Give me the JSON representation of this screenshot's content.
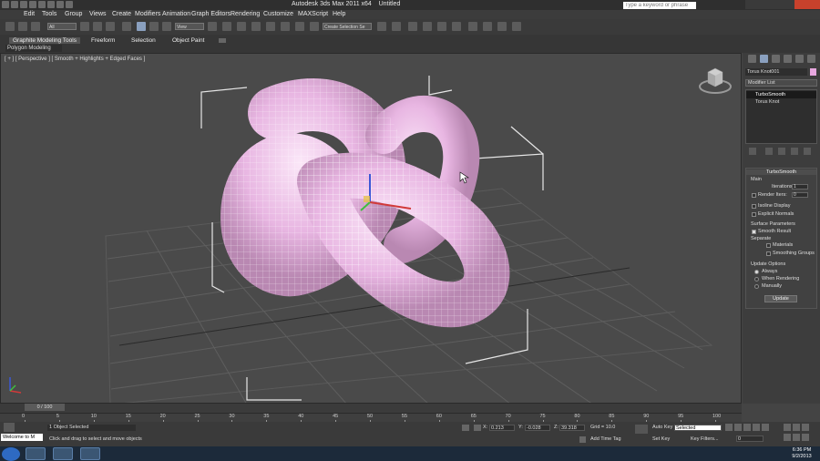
{
  "app": {
    "title": "Autodesk 3ds Max 2011 x64",
    "document": "Untitled",
    "search_placeholder": "Type a keyword or phrase"
  },
  "menu": [
    "Edit",
    "Tools",
    "Group",
    "Views",
    "Create",
    "Modifiers",
    "Animation",
    "Graph Editors",
    "Rendering",
    "Customize",
    "MAXScript",
    "Help"
  ],
  "toolbar": {
    "selection_filter": "All",
    "ref_coord": "View",
    "named_selection": "Create Selection Se"
  },
  "ribbon": {
    "tabs": [
      "Graphite Modeling Tools",
      "Freeform",
      "Selection",
      "Object Paint"
    ],
    "subtab": "Polygon Modeling"
  },
  "viewport": {
    "label": "[ + ] [ Perspective ] [ Smooth + Highlights + Edged Faces ]",
    "object_color": "#e8b6e2"
  },
  "command_panel": {
    "object_name": "Torus Knot001",
    "object_color": "#e8a8e0",
    "modifier_list": "Modifier List",
    "stack": [
      "TurboSmooth",
      "Torus Knot"
    ],
    "rollout": {
      "title": "TurboSmooth",
      "main_group": "Main",
      "iterations_label": "Iterations:",
      "iterations": "1",
      "render_iters_label": "Render Iters:",
      "render_iters": "0",
      "isoline_label": "Isoline Display",
      "explicit_normals_label": "Explicit Normals",
      "surface_group": "Surface Parameters",
      "smooth_result_label": "Smooth Result",
      "separate_label": "Separate",
      "materials_label": "Materials",
      "smoothing_groups_label": "Smoothing Groups",
      "update_group": "Update Options",
      "always_label": "Always",
      "when_rendering_label": "When Rendering",
      "manually_label": "Manually",
      "update_button": "Update"
    }
  },
  "timeline": {
    "slider": "0 / 100",
    "ticks": [
      "0",
      "5",
      "10",
      "15",
      "20",
      "25",
      "30",
      "35",
      "40",
      "45",
      "50",
      "55",
      "60",
      "65",
      "70",
      "75",
      "80",
      "85",
      "90",
      "95",
      "100"
    ]
  },
  "status": {
    "welcome": "Welcome to M",
    "selection": "1 Object Selected",
    "prompt": "Click and drag to select and move objects",
    "x_label": "X:",
    "x": "0.213",
    "y_label": "Y:",
    "y": "-0.028",
    "z_label": "Z:",
    "z": "39.318",
    "grid": "Grid = 10.0",
    "add_time_tag": "Add Time Tag",
    "auto_key": "Auto Key",
    "selected": "Selected",
    "set_key": "Set Key",
    "key_filters": "Key Filters...",
    "frame": "0"
  },
  "clock": {
    "time": "6:36 PM",
    "date": "9/2/2013"
  }
}
